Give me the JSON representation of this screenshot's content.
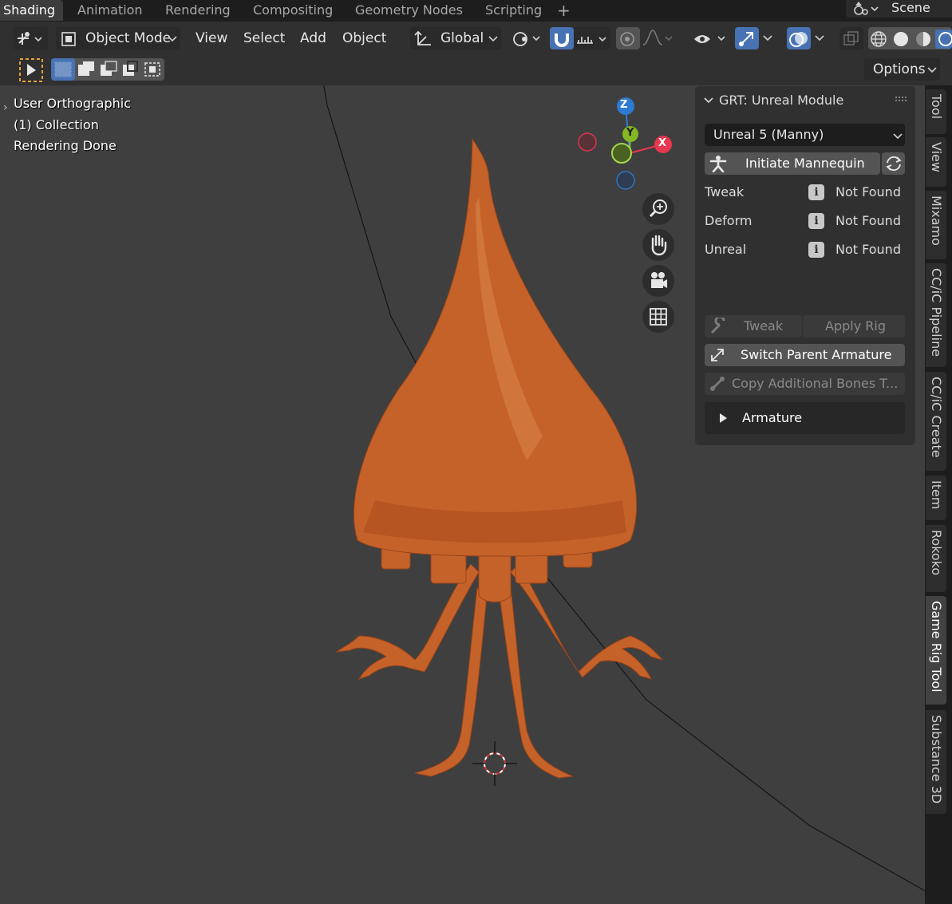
{
  "workspace_tabs": [
    "Shading",
    "Animation",
    "Rendering",
    "Compositing",
    "Geometry Nodes",
    "Scripting"
  ],
  "add_tab_glyph": "+",
  "scene": {
    "label": "Scene",
    "icon": "scene-icon"
  },
  "header": {
    "mode": "Object Mode",
    "menus": [
      "View",
      "Select",
      "Add",
      "Object"
    ],
    "transform_orientation": "Global"
  },
  "toolrow": {
    "options_label": "Options"
  },
  "viewport": {
    "view_name": "User Orthographic",
    "collection": "(1) Collection",
    "status": "Rendering Done",
    "gizmo_axes": {
      "z": "Z",
      "y": "Y",
      "x": "X"
    }
  },
  "panel": {
    "title": "GRT: Unreal Module",
    "rig_select": "Unreal 5 (Manny)",
    "initiate_button": "Initiate Mannequin",
    "status_rows": [
      {
        "label": "Tweak",
        "value": "Not Found"
      },
      {
        "label": "Deform",
        "value": "Not Found"
      },
      {
        "label": "Unreal",
        "value": "Not Found"
      }
    ],
    "tweak_button": "Tweak",
    "apply_rig_button": "Apply Rig",
    "switch_parent_button": "Switch Parent Armature",
    "copy_bones_button": "Copy Additional Bones T...",
    "armature_section": "Armature"
  },
  "side_tabs": [
    "Tool",
    "View",
    "Mixamo",
    "CC/iC Pipeline",
    "CC/iC Create",
    "Item",
    "Rokoko",
    "Game Rig Tool",
    "Substance 3D"
  ],
  "active_side_tab": "Game Rig Tool",
  "colors": {
    "accent_blue": "#4772b3",
    "axis_x": "#e8374f",
    "axis_y": "#83b725",
    "axis_z": "#2e7ad0",
    "viewport_bg": "#3f3f3f",
    "model_orange": "#c5622a"
  }
}
